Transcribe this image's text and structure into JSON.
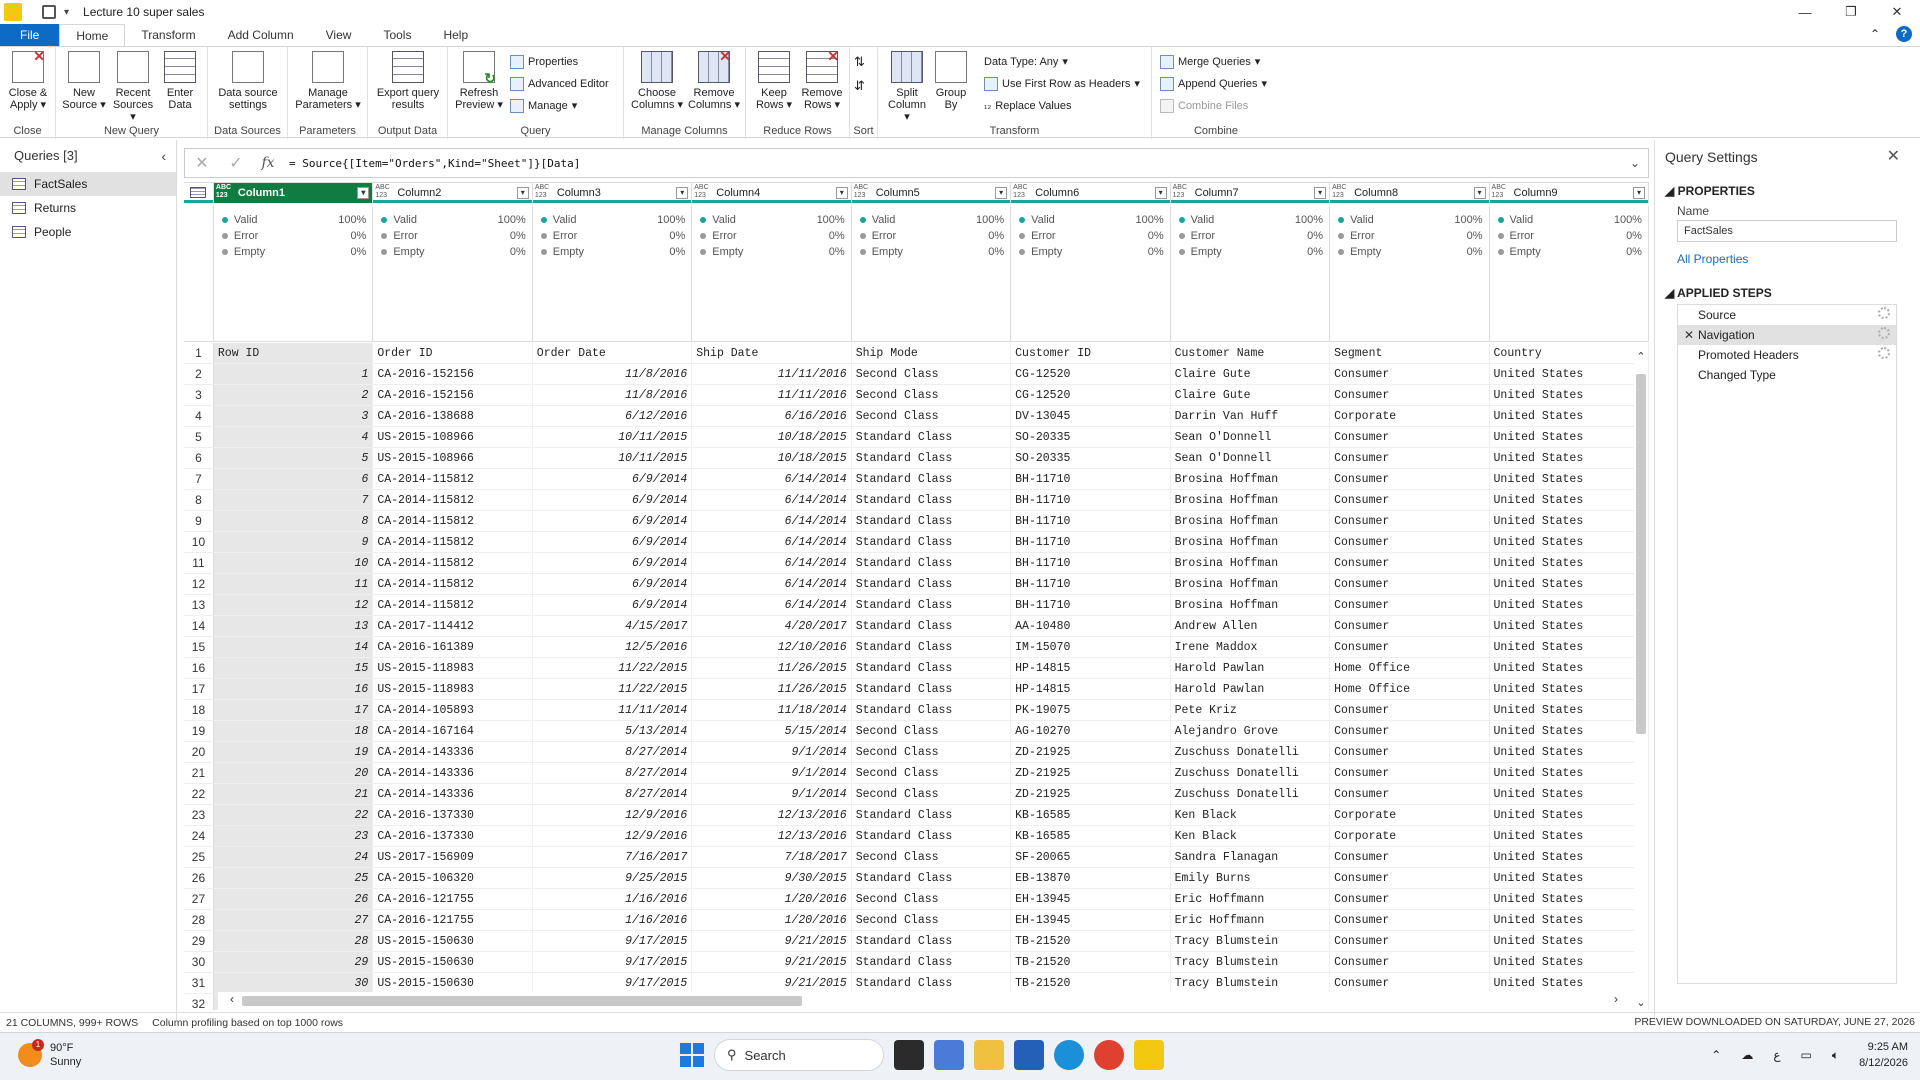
{
  "window": {
    "title": "Lecture 10 super sales",
    "controls": [
      "—",
      "❐",
      "✕"
    ]
  },
  "ribbon_tabs": [
    "File",
    "Home",
    "Transform",
    "Add Column",
    "View",
    "Tools",
    "Help"
  ],
  "ribbon": {
    "close_apply": "Close & Apply",
    "new_source": "New Source",
    "recent_sources": "Recent Sources",
    "enter_data": "Enter Data",
    "data_source_settings": "Data source settings",
    "manage_parameters": "Manage Parameters",
    "export_query_results": "Export query results",
    "refresh_preview": "Refresh Preview",
    "properties": "Properties",
    "advanced_editor": "Advanced Editor",
    "manage": "Manage",
    "choose_columns": "Choose Columns",
    "remove_columns": "Remove Columns",
    "keep_rows": "Keep Rows",
    "remove_rows": "Remove Rows",
    "split_column": "Split Column",
    "group_by": "Group By",
    "data_type": "Data Type: Any",
    "use_first_row": "Use First Row as Headers",
    "replace_values": "Replace Values",
    "merge_queries": "Merge Queries",
    "append_queries": "Append Queries",
    "combine_files": "Combine Files",
    "groups": {
      "close": "Close",
      "new_query": "New Query",
      "data_sources": "Data Sources",
      "parameters": "Parameters",
      "output_data": "Output Data",
      "query": "Query",
      "manage_columns": "Manage Columns",
      "reduce_rows": "Reduce Rows",
      "sort": "Sort",
      "transform": "Transform",
      "combine": "Combine"
    }
  },
  "queries": {
    "header": "Queries [3]",
    "items": [
      "FactSales",
      "Returns",
      "People"
    ]
  },
  "formula": "= Source{[Item=\"Orders\",Kind=\"Sheet\"]}[Data]",
  "columns": [
    {
      "type": "ABC 123",
      "name": "Column1"
    },
    {
      "type": "ABC 123",
      "name": "Column2"
    },
    {
      "type": "ABC 123",
      "name": "Column3"
    },
    {
      "type": "ABC 123",
      "name": "Column4"
    },
    {
      "type": "ABC 123",
      "name": "Column5"
    },
    {
      "type": "ABC 123",
      "name": "Column6"
    },
    {
      "type": "ABC 123",
      "name": "Column7"
    },
    {
      "type": "ABC 123",
      "name": "Column8"
    },
    {
      "type": "ABC 123",
      "name": "Column9"
    }
  ],
  "profile": {
    "valid": "Valid",
    "valid_pct": "100%",
    "error": "Error",
    "error_pct": "0%",
    "empty": "Empty",
    "empty_pct": "0%"
  },
  "row_numbers": [
    "1",
    "2",
    "3",
    "4",
    "5",
    "6",
    "7",
    "8",
    "9",
    "10",
    "11",
    "12",
    "13",
    "14",
    "15",
    "16",
    "17",
    "18",
    "19",
    "20",
    "21",
    "22",
    "23",
    "24",
    "25",
    "26",
    "27",
    "28",
    "29",
    "30",
    "31",
    "32"
  ],
  "rows": [
    [
      "Row ID",
      "Order ID",
      "Order Date",
      "Ship Date",
      "Ship Mode",
      "Customer ID",
      "Customer Name",
      "Segment",
      "Country"
    ],
    [
      "1",
      "CA-2016-152156",
      "11/8/2016",
      "11/11/2016",
      "Second Class",
      "CG-12520",
      "Claire Gute",
      "Consumer",
      "United States"
    ],
    [
      "2",
      "CA-2016-152156",
      "11/8/2016",
      "11/11/2016",
      "Second Class",
      "CG-12520",
      "Claire Gute",
      "Consumer",
      "United States"
    ],
    [
      "3",
      "CA-2016-138688",
      "6/12/2016",
      "6/16/2016",
      "Second Class",
      "DV-13045",
      "Darrin Van Huff",
      "Corporate",
      "United States"
    ],
    [
      "4",
      "US-2015-108966",
      "10/11/2015",
      "10/18/2015",
      "Standard Class",
      "SO-20335",
      "Sean O'Donnell",
      "Consumer",
      "United States"
    ],
    [
      "5",
      "US-2015-108966",
      "10/11/2015",
      "10/18/2015",
      "Standard Class",
      "SO-20335",
      "Sean O'Donnell",
      "Consumer",
      "United States"
    ],
    [
      "6",
      "CA-2014-115812",
      "6/9/2014",
      "6/14/2014",
      "Standard Class",
      "BH-11710",
      "Brosina Hoffman",
      "Consumer",
      "United States"
    ],
    [
      "7",
      "CA-2014-115812",
      "6/9/2014",
      "6/14/2014",
      "Standard Class",
      "BH-11710",
      "Brosina Hoffman",
      "Consumer",
      "United States"
    ],
    [
      "8",
      "CA-2014-115812",
      "6/9/2014",
      "6/14/2014",
      "Standard Class",
      "BH-11710",
      "Brosina Hoffman",
      "Consumer",
      "United States"
    ],
    [
      "9",
      "CA-2014-115812",
      "6/9/2014",
      "6/14/2014",
      "Standard Class",
      "BH-11710",
      "Brosina Hoffman",
      "Consumer",
      "United States"
    ],
    [
      "10",
      "CA-2014-115812",
      "6/9/2014",
      "6/14/2014",
      "Standard Class",
      "BH-11710",
      "Brosina Hoffman",
      "Consumer",
      "United States"
    ],
    [
      "11",
      "CA-2014-115812",
      "6/9/2014",
      "6/14/2014",
      "Standard Class",
      "BH-11710",
      "Brosina Hoffman",
      "Consumer",
      "United States"
    ],
    [
      "12",
      "CA-2014-115812",
      "6/9/2014",
      "6/14/2014",
      "Standard Class",
      "BH-11710",
      "Brosina Hoffman",
      "Consumer",
      "United States"
    ],
    [
      "13",
      "CA-2017-114412",
      "4/15/2017",
      "4/20/2017",
      "Standard Class",
      "AA-10480",
      "Andrew Allen",
      "Consumer",
      "United States"
    ],
    [
      "14",
      "CA-2016-161389",
      "12/5/2016",
      "12/10/2016",
      "Standard Class",
      "IM-15070",
      "Irene Maddox",
      "Consumer",
      "United States"
    ],
    [
      "15",
      "US-2015-118983",
      "11/22/2015",
      "11/26/2015",
      "Standard Class",
      "HP-14815",
      "Harold Pawlan",
      "Home Office",
      "United States"
    ],
    [
      "16",
      "US-2015-118983",
      "11/22/2015",
      "11/26/2015",
      "Standard Class",
      "HP-14815",
      "Harold Pawlan",
      "Home Office",
      "United States"
    ],
    [
      "17",
      "CA-2014-105893",
      "11/11/2014",
      "11/18/2014",
      "Standard Class",
      "PK-19075",
      "Pete Kriz",
      "Consumer",
      "United States"
    ],
    [
      "18",
      "CA-2014-167164",
      "5/13/2014",
      "5/15/2014",
      "Second Class",
      "AG-10270",
      "Alejandro Grove",
      "Consumer",
      "United States"
    ],
    [
      "19",
      "CA-2014-143336",
      "8/27/2014",
      "9/1/2014",
      "Second Class",
      "ZD-21925",
      "Zuschuss Donatelli",
      "Consumer",
      "United States"
    ],
    [
      "20",
      "CA-2014-143336",
      "8/27/2014",
      "9/1/2014",
      "Second Class",
      "ZD-21925",
      "Zuschuss Donatelli",
      "Consumer",
      "United States"
    ],
    [
      "21",
      "CA-2014-143336",
      "8/27/2014",
      "9/1/2014",
      "Second Class",
      "ZD-21925",
      "Zuschuss Donatelli",
      "Consumer",
      "United States"
    ],
    [
      "22",
      "CA-2016-137330",
      "12/9/2016",
      "12/13/2016",
      "Standard Class",
      "KB-16585",
      "Ken Black",
      "Corporate",
      "United States"
    ],
    [
      "23",
      "CA-2016-137330",
      "12/9/2016",
      "12/13/2016",
      "Standard Class",
      "KB-16585",
      "Ken Black",
      "Corporate",
      "United States"
    ],
    [
      "24",
      "US-2017-156909",
      "7/16/2017",
      "7/18/2017",
      "Second Class",
      "SF-20065",
      "Sandra Flanagan",
      "Consumer",
      "United States"
    ],
    [
      "25",
      "CA-2015-106320",
      "9/25/2015",
      "9/30/2015",
      "Standard Class",
      "EB-13870",
      "Emily Burns",
      "Consumer",
      "United States"
    ],
    [
      "26",
      "CA-2016-121755",
      "1/16/2016",
      "1/20/2016",
      "Second Class",
      "EH-13945",
      "Eric Hoffmann",
      "Consumer",
      "United States"
    ],
    [
      "27",
      "CA-2016-121755",
      "1/16/2016",
      "1/20/2016",
      "Second Class",
      "EH-13945",
      "Eric Hoffmann",
      "Consumer",
      "United States"
    ],
    [
      "28",
      "US-2015-150630",
      "9/17/2015",
      "9/21/2015",
      "Standard Class",
      "TB-21520",
      "Tracy Blumstein",
      "Consumer",
      "United States"
    ],
    [
      "29",
      "US-2015-150630",
      "9/17/2015",
      "9/21/2015",
      "Standard Class",
      "TB-21520",
      "Tracy Blumstein",
      "Consumer",
      "United States"
    ],
    [
      "30",
      "US-2015-150630",
      "9/17/2015",
      "9/21/2015",
      "Standard Class",
      "TB-21520",
      "Tracy Blumstein",
      "Consumer",
      "United States"
    ]
  ],
  "settings": {
    "title": "Query Settings",
    "properties": "PROPERTIES",
    "name_label": "Name",
    "name_value": "FactSales",
    "all_properties": "All Properties",
    "applied_steps": "APPLIED STEPS",
    "steps": [
      "Source",
      "Navigation",
      "Promoted Headers",
      "Changed Type"
    ]
  },
  "status": {
    "columns": "21 COLUMNS, 999+ ROWS",
    "profiling": "Column profiling based on top 1000 rows",
    "preview": "PREVIEW DOWNLOADED ON SATURDAY, JUNE 27, 2026"
  },
  "taskbar": {
    "temp": "90°F",
    "condition": "Sunny",
    "badge": "1",
    "search": "Search",
    "time": "9:25 AM",
    "date": "8/12/2026",
    "lang": "ع"
  },
  "colors": {
    "accent": "#0e6bc5",
    "profile_valid": "#1ba39c",
    "selected_col": "#107c41"
  }
}
